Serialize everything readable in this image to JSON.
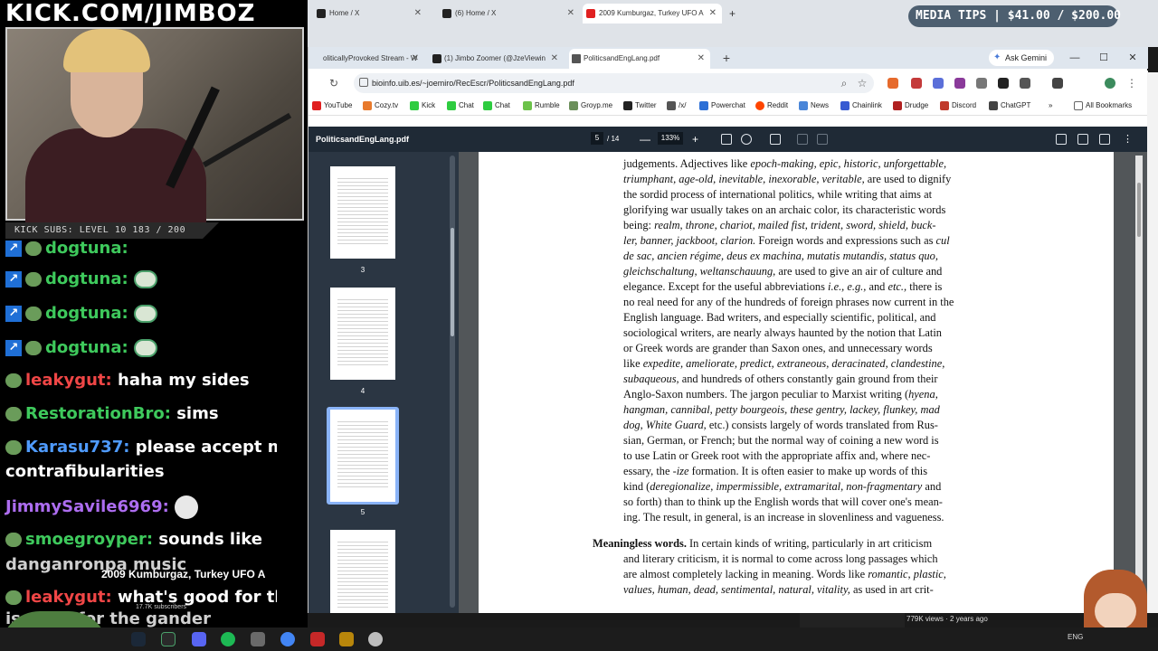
{
  "overlay": {
    "brand": "KICK.COM/JIMBOZ",
    "subs_bar": "KICK SUBS: LEVEL 10 183 / 200",
    "media_tips": "MEDIA TIPS | $41.00 / $200.00",
    "chat": [
      {
        "user": "dogtuna:",
        "text": "",
        "color": "green"
      },
      {
        "user": "dogtuna:",
        "text": "",
        "color": "green"
      },
      {
        "user": "dogtuna:",
        "text": "",
        "color": "green"
      },
      {
        "user": "dogtuna:",
        "text": "",
        "color": "green"
      },
      {
        "user": "leakygut:",
        "text": "haha my sides",
        "color": "red"
      },
      {
        "user": "RestorationBro:",
        "text": "sims",
        "color": "green"
      },
      {
        "user": "Karasu737:",
        "text": "please accept my",
        "color": "blue"
      },
      {
        "user": "",
        "text": "contrafibularities",
        "color": "white"
      },
      {
        "user": "JimmySavile6969:",
        "text": "",
        "color": "purple"
      },
      {
        "user": "smoegroyper:",
        "text": "sounds like",
        "color": "green"
      },
      {
        "user": "",
        "text": "danganronpa music",
        "color": "white"
      },
      {
        "user": "leakygut:",
        "text": "what's good for the goose",
        "color": "red"
      },
      {
        "user": "",
        "text": "is good for the gander",
        "color": "white"
      }
    ],
    "yt_title": "2009 Kumburgaz, Turkey UFO A",
    "yt_subs": "17.7K subscribers",
    "yt_meta": "779K views · 2 years ago",
    "taskbar_lang": "ENG"
  },
  "back_window": {
    "tabs": [
      {
        "label": "Home / X",
        "active": false
      },
      {
        "label": "(6) Home / X",
        "active": false
      },
      {
        "label": "2009 Kumburgaz, Turkey UFO A",
        "active": true
      }
    ]
  },
  "browser": {
    "tabs": [
      {
        "label": "oliticallyProvoked Stream - W",
        "active": false
      },
      {
        "label": "(1) Jimbo Zoomer (@JzeViewin",
        "active": false
      },
      {
        "label": "PoliticsandEngLang.pdf",
        "active": true
      }
    ],
    "ask_gemini": "Ask Gemini",
    "url": "bioinfo.uib.es/~joemiro/RecEscr/PoliticsandEngLang.pdf",
    "bookmarks": [
      "YouTube",
      "Cozy.tv",
      "Kick",
      "Chat",
      "Chat",
      "Rumble",
      "Groyp.me",
      "Twitter",
      "/x/",
      "Powerchat",
      "Reddit",
      "News",
      "Chainlink",
      "Drudge",
      "Discord",
      "ChatGPT"
    ],
    "all_bookmarks": "All Bookmarks"
  },
  "pdf": {
    "title": "PoliticsandEngLang.pdf",
    "current_page": "5",
    "total_pages": "/ 14",
    "zoom": "133%",
    "thumbs": [
      "3",
      "4",
      "5"
    ]
  }
}
